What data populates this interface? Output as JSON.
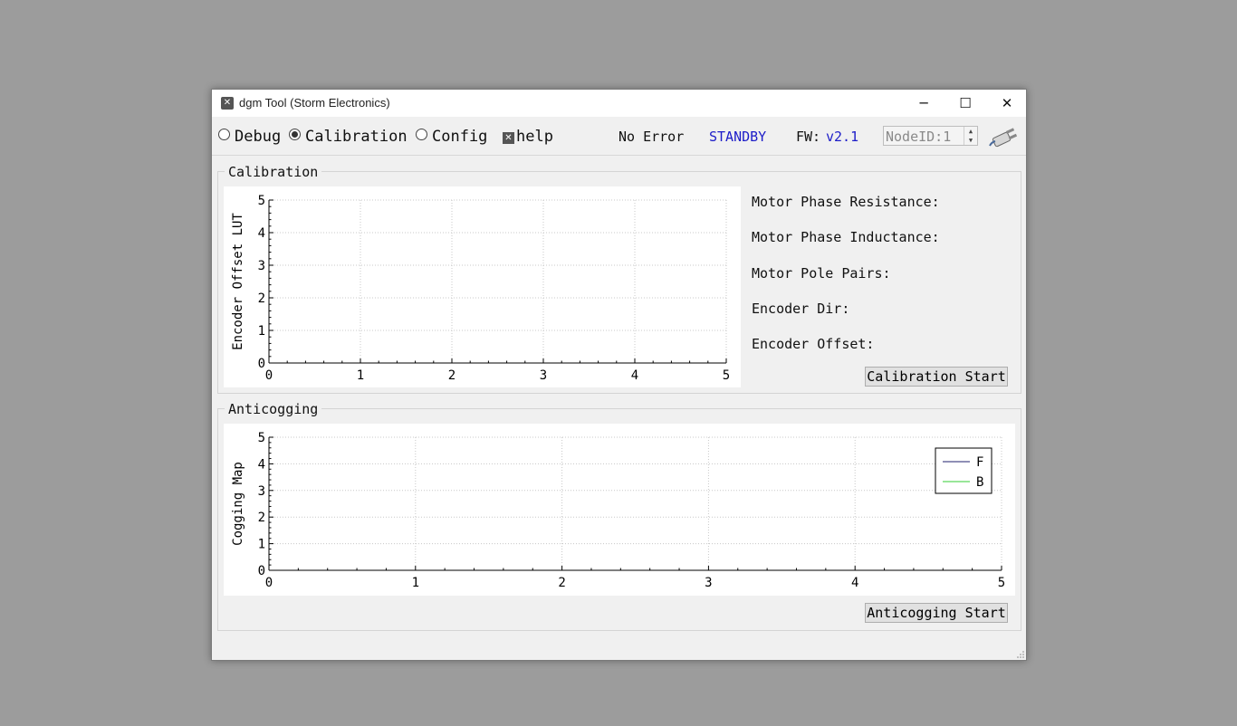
{
  "window": {
    "title": "dgm Tool (Storm Electronics)",
    "icon": "tool-icon",
    "controls": {
      "minimize": "─",
      "maximize": "☐",
      "close": "✕"
    }
  },
  "toolbar": {
    "modes": [
      {
        "label": "Debug",
        "selected": false
      },
      {
        "label": "Calibration",
        "selected": true
      },
      {
        "label": "Config",
        "selected": false
      }
    ],
    "help": {
      "label": "help",
      "checked": true
    },
    "status": "No Error",
    "state": "STANDBY",
    "fw_label": "FW:",
    "fw_version": "v2.1",
    "node_id": "NodeID:1",
    "connect_icon": "plug-icon",
    "state_color": "#1d1dc8"
  },
  "calibration": {
    "title": "Calibration",
    "info": [
      "Motor Phase Resistance:",
      "Motor Phase Inductance:",
      "Motor Pole Pairs:",
      "Encoder Dir:",
      "Encoder Offset:"
    ],
    "start_label": "Calibration Start"
  },
  "anticogging": {
    "title": "Anticogging",
    "start_label": "Anticogging Start"
  },
  "chart_data": [
    {
      "type": "line",
      "ylabel": "Encoder Offset LUT",
      "xlabel": "",
      "xlim": [
        0,
        5
      ],
      "ylim": [
        0,
        5
      ],
      "x_ticks": [
        "0",
        "1",
        "2",
        "3",
        "4",
        "5"
      ],
      "y_ticks": [
        "0",
        "1",
        "2",
        "3",
        "4",
        "5"
      ],
      "grid": true,
      "series": []
    },
    {
      "type": "line",
      "ylabel": "Cogging Map",
      "xlabel": "",
      "xlim": [
        0,
        5
      ],
      "ylim": [
        0,
        5
      ],
      "x_ticks": [
        "0",
        "1",
        "2",
        "3",
        "4",
        "5"
      ],
      "y_ticks": [
        "0",
        "1",
        "2",
        "3",
        "4",
        "5"
      ],
      "grid": true,
      "legend_position": "top-right",
      "series": [
        {
          "name": "F",
          "color": "#1f1f6e",
          "values": []
        },
        {
          "name": "B",
          "color": "#33cc33",
          "values": []
        }
      ]
    }
  ]
}
